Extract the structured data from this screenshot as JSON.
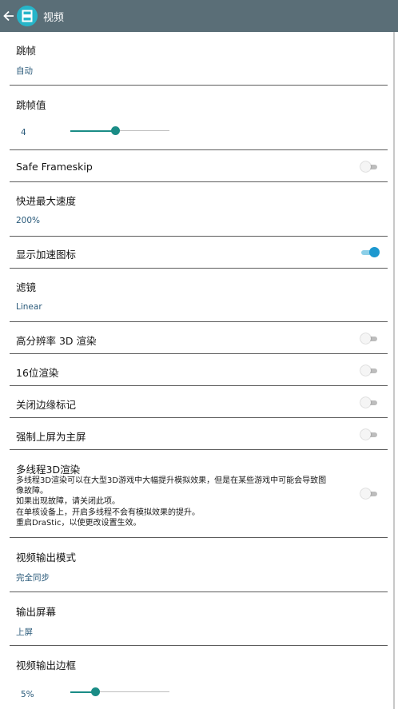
{
  "header": {
    "title": "视频",
    "back_icon": "arrow-left-icon",
    "app_icon": "drastic-app-icon"
  },
  "colors": {
    "appbar": "#5a6e77",
    "accent": "#1d98cf",
    "slider": "#1a8c86",
    "summary": "#2a5a7a"
  },
  "settings": {
    "frameskip": {
      "title": "跳帧",
      "value": "自动"
    },
    "frameskip_value": {
      "title": "跳帧值",
      "value": "4",
      "level": 0.45
    },
    "safe_frameskip": {
      "title": "Safe Frameskip",
      "enabled": false
    },
    "fast_forward": {
      "title": "快进最大速度",
      "value": "200%"
    },
    "show_speed_icon": {
      "title": "显示加速图标",
      "enabled": true
    },
    "filter": {
      "title": "滤镜",
      "value": "Linear"
    },
    "high_res_3d": {
      "title": "高分辨率 3D 渲染",
      "enabled": false
    },
    "render_16bit": {
      "title": "16位渲染",
      "enabled": false
    },
    "edge_marking": {
      "title": "关闭边缘标记",
      "enabled": false
    },
    "force_top_main": {
      "title": "强制上屏为主屏",
      "enabled": false
    },
    "multithread_3d": {
      "title": "多线程3D渲染",
      "desc": [
        "多线程3D渲染可以在大型3D游戏中大幅提升模拟效果，但是在某些游戏中可能会导致图",
        "像故障。",
        "如果出现故障，请关闭此项。",
        "在单核设备上，开启多线程不会有模拟效果的提升。",
        "重启DraStic，以使更改设置生效。"
      ],
      "enabled": false
    },
    "video_output_mode": {
      "title": "视频输出模式",
      "value": "完全同步"
    },
    "output_screen": {
      "title": "输出屏幕",
      "value": "上屏"
    },
    "video_border": {
      "title": "视频输出边框",
      "value": "5%",
      "level": 0.25
    }
  }
}
